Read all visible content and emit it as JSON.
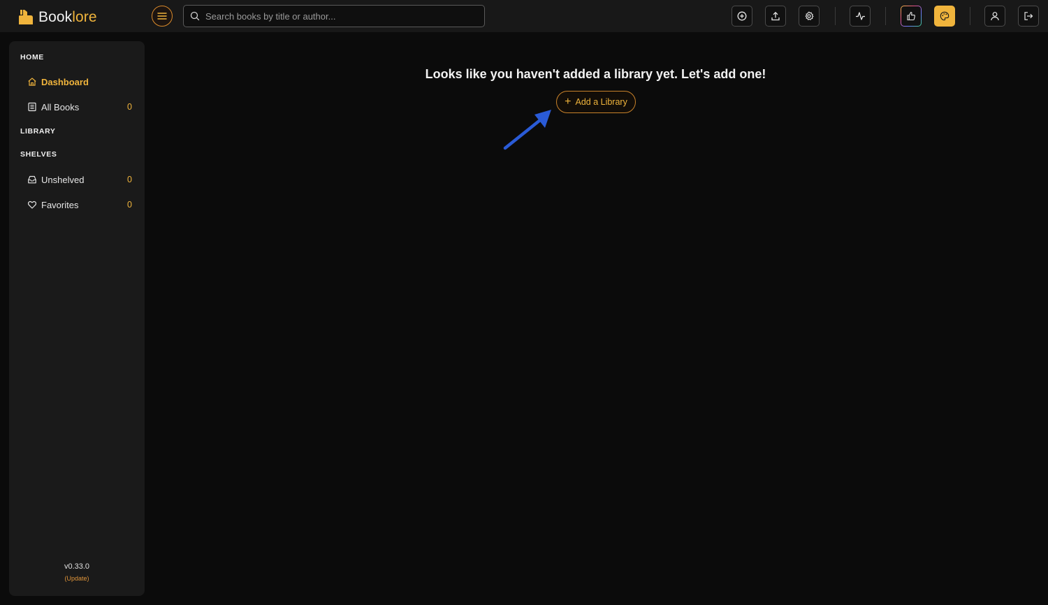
{
  "app": {
    "logo_text_main": "Book",
    "logo_text_accent": "lore",
    "accent_color": "#f0b43c"
  },
  "header": {
    "search_placeholder": "Search books by title or author...",
    "icons": [
      "menu-icon",
      "search-icon",
      "plus-circle-icon",
      "upload-icon",
      "gear-icon",
      "activity-icon",
      "thumbs-up-icon",
      "palette-icon",
      "user-icon",
      "logout-icon"
    ]
  },
  "sidebar": {
    "home_title": "HOME",
    "library_title": "LIBRARY",
    "shelves_title": "SHELVES",
    "items": [
      {
        "label": "Dashboard",
        "count": ""
      },
      {
        "label": "All Books",
        "count": "0"
      },
      {
        "label": "Unshelved",
        "count": "0"
      },
      {
        "label": "Favorites",
        "count": "0"
      }
    ],
    "version": "v0.33.0",
    "update_label": "(Update)"
  },
  "main": {
    "empty_message": "Looks like you haven't added a library yet. Let's add one!",
    "add_library_label": "Add a Library",
    "annotation_arrow_color": "#2a5bd7"
  }
}
